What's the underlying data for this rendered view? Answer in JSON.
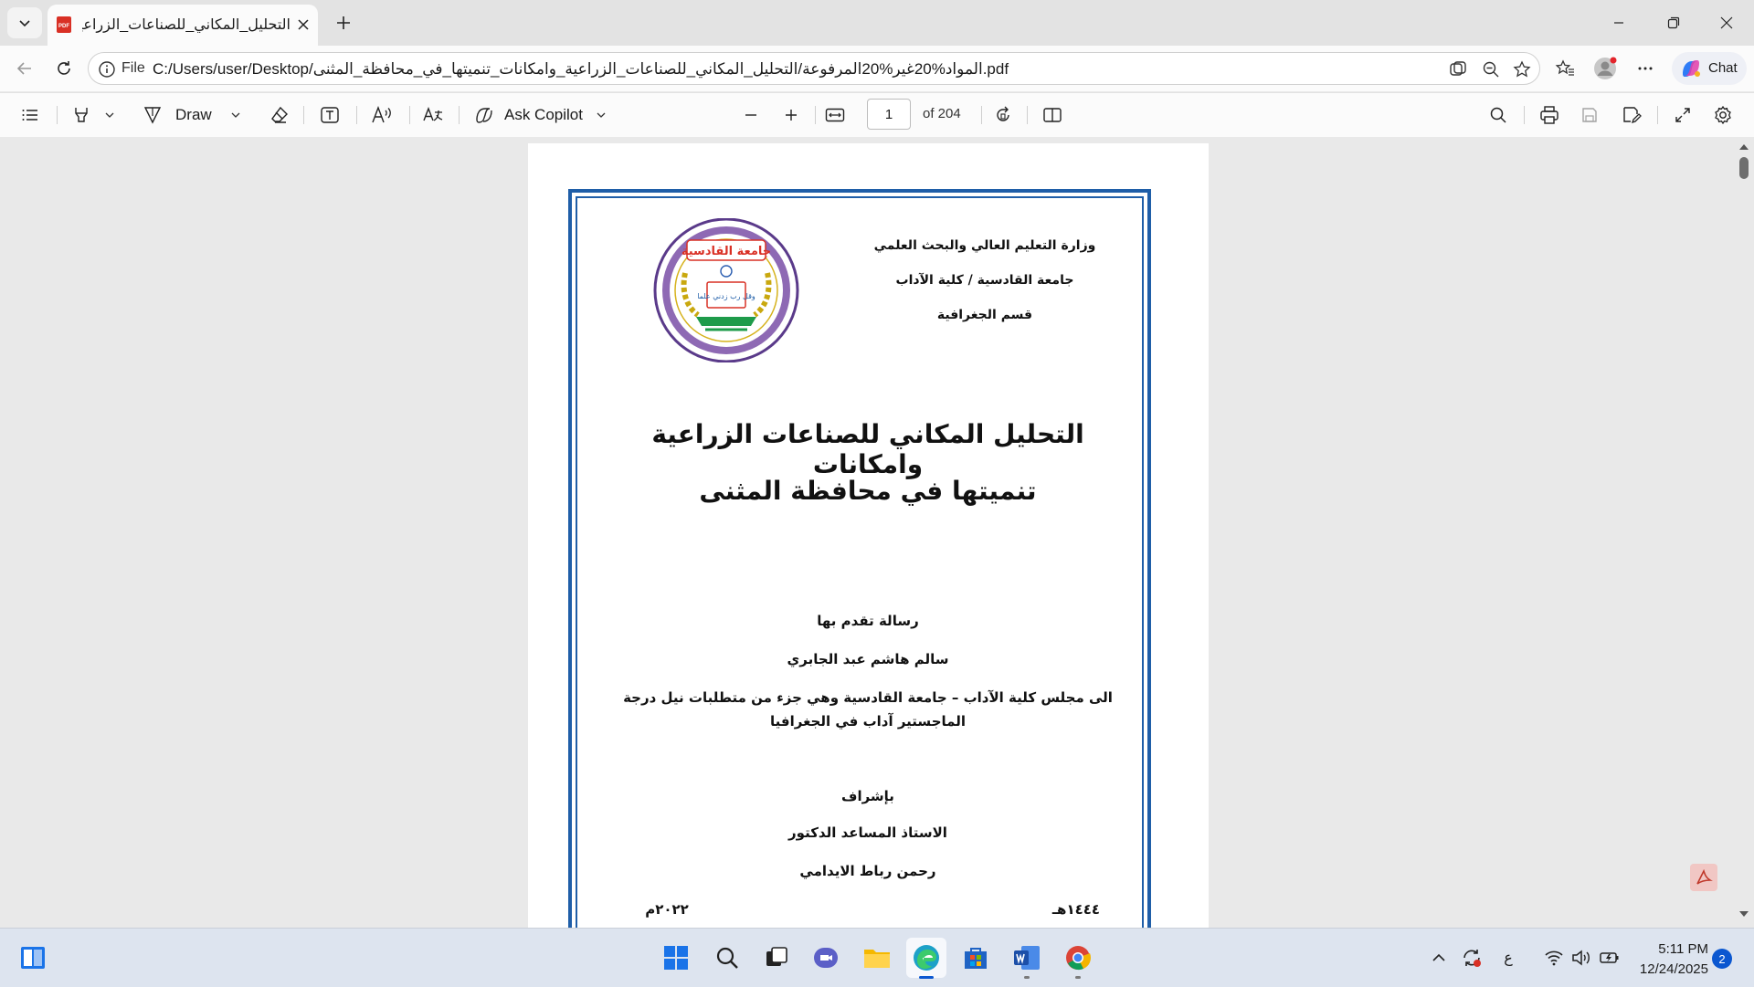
{
  "tab": {
    "title": "التحليل_المكاني_للصناعات_الزراعية_و"
  },
  "address": {
    "scheme_label": "File",
    "url": "C:/Users/user/Desktop/المواد%20غير%20المرفوعة/التحليل_المكاني_للصناعات_الزراعية_وامكانات_تنميتها_في_محافظة_المثنى.pdf"
  },
  "chat": {
    "label": "Chat"
  },
  "toolbar": {
    "draw_label": "Draw",
    "copilot_label": "Ask Copilot",
    "page_number": "1",
    "page_count": "of 204"
  },
  "document": {
    "header_line1": "وزارة التعليم العالي والبحث العلمي",
    "header_line2": "جامعة القادسية / كلية الآداب",
    "header_line3": "قسم الجغرافية",
    "logo_text": "جامعة القادسية",
    "logo_motto": "وقل رب زدني علما",
    "title_line1": "التحليل المكاني للصناعات الزراعية وامكانات",
    "title_line2": "تنميتها في محافظة المثنى",
    "submitted_by": "رسالة تقدم بها",
    "author": "سالم هاشم عبد الجابري",
    "council_line1": "الى مجلس كلية الآداب – جامعة القادسية وهي جزء من متطلبات نيل درجة",
    "council_line2": "الماجستير آداب في الجغرافيا",
    "supervision": "بإشراف",
    "supervisor_title": "الاستاذ المساعد الدكتور",
    "supervisor_name": "رحمن رباط  الايدامي",
    "date_hijri": "١٤٤٤هـ",
    "date_gregorian": "٢٠٢٢م"
  },
  "taskbar": {
    "time": "5:11 PM",
    "date": "12/24/2025",
    "notifications": "2",
    "input_lang": "ع"
  },
  "colors": {
    "frame": "#1f5ea8",
    "accent": "#0b57d0"
  }
}
